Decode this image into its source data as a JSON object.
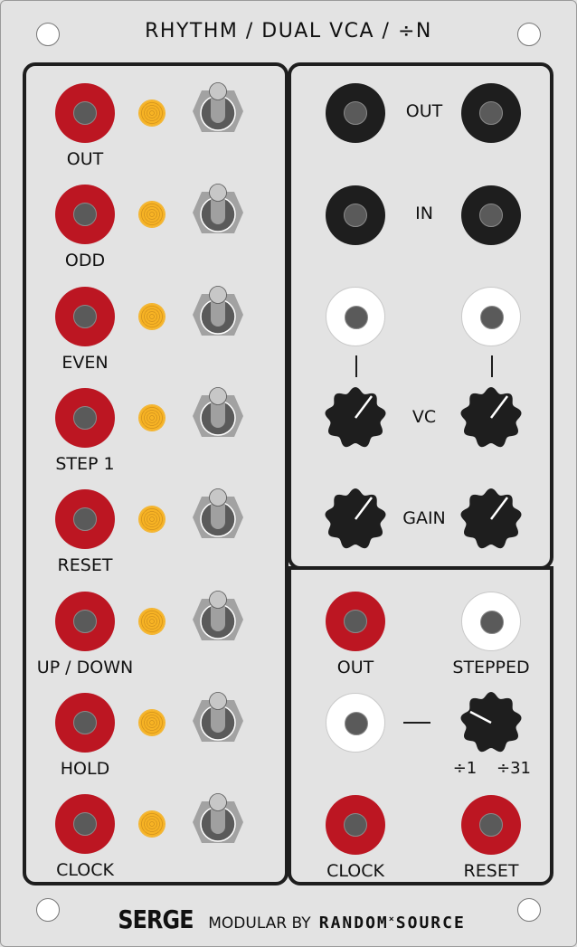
{
  "module": {
    "title": "RHYTHM / DUAL VCA / ÷N",
    "colors": {
      "panel": "#e3e3e3",
      "jack_red": "#bc1622",
      "jack_black": "#1e1e1e",
      "jack_white": "#ffffff",
      "led": "#f7b324",
      "knob": "#1e1e1e"
    }
  },
  "rhythm": {
    "rows": [
      {
        "label": "OUT"
      },
      {
        "label": "ODD"
      },
      {
        "label": "EVEN"
      },
      {
        "label": "STEP 1"
      },
      {
        "label": "RESET"
      },
      {
        "label": "UP / DOWN"
      },
      {
        "label": "HOLD"
      },
      {
        "label": "CLOCK"
      }
    ]
  },
  "vca": {
    "out_label": "OUT",
    "in_label": "IN",
    "vc_label": "VC",
    "gain_label": "GAIN"
  },
  "divider": {
    "out_label": "OUT",
    "stepped_label": "STEPPED",
    "min_label": "÷1",
    "max_label": "÷31",
    "clock_label": "CLOCK",
    "reset_label": "RESET"
  },
  "footer": {
    "brand": "SERGE",
    "middle": "MODULAR BY",
    "maker_a": "RANDOM",
    "maker_sep": "×",
    "maker_b": "SOURCE"
  }
}
